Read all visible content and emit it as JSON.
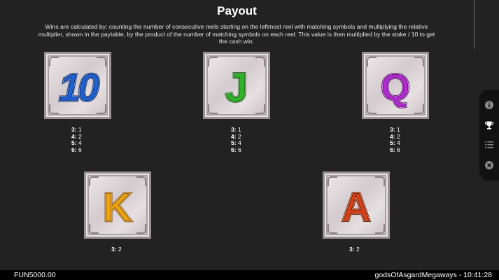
{
  "header": {
    "title": "Payout",
    "description": "Wins are calculated by: counting the number of consecutive reels starting on the leftmost reel with matching symbols and multiplying the relative multiplier, shown in the paytable, by the product of the number of matching symbols on each reel. This value is then multiplied by the stake / 10 to get the cash win."
  },
  "symbols": [
    {
      "name": "10",
      "payouts": [
        {
          "count": "3:",
          "value": "1"
        },
        {
          "count": "4:",
          "value": "2"
        },
        {
          "count": "5:",
          "value": "4"
        },
        {
          "count": "6:",
          "value": "6"
        }
      ]
    },
    {
      "name": "J",
      "payouts": [
        {
          "count": "3:",
          "value": "1"
        },
        {
          "count": "4:",
          "value": "2"
        },
        {
          "count": "5:",
          "value": "4"
        },
        {
          "count": "6:",
          "value": "6"
        }
      ]
    },
    {
      "name": "Q",
      "payouts": [
        {
          "count": "3:",
          "value": "1"
        },
        {
          "count": "4:",
          "value": "2"
        },
        {
          "count": "5:",
          "value": "4"
        },
        {
          "count": "6:",
          "value": "6"
        }
      ]
    },
    {
      "name": "K",
      "payouts": [
        {
          "count": "3:",
          "value": "2"
        }
      ]
    },
    {
      "name": "A",
      "payouts": [
        {
          "count": "3:",
          "value": "2"
        }
      ]
    }
  ],
  "side_panel": {
    "items": [
      {
        "icon": "info-icon"
      },
      {
        "icon": "trophy-icon"
      },
      {
        "icon": "list-icon"
      },
      {
        "icon": "close-icon"
      }
    ]
  },
  "footer": {
    "balance": "FUN5000.00",
    "game_info": "godsOfAsgardMegaways - 10:41:28"
  },
  "colors": {
    "background": "#222222",
    "symbol_10": "#1e63d6",
    "symbol_j": "#2fb52a",
    "symbol_q": "#b62ad6",
    "symbol_k": "#f0a410",
    "symbol_a": "#d8401a"
  }
}
